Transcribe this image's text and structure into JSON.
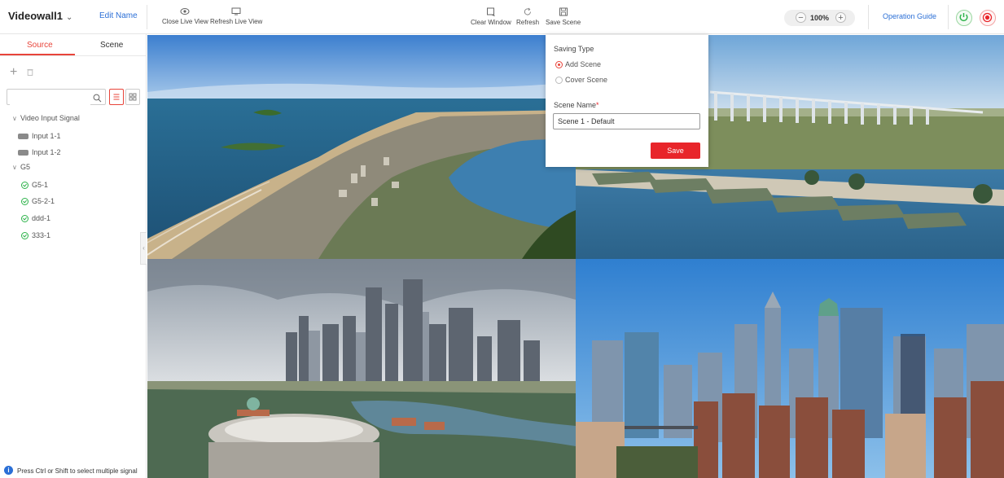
{
  "header": {
    "wall_name": "Videowall1",
    "edit_name": "Edit Name",
    "toolbar_left": [
      {
        "label": "Close Live View",
        "icon": "eye-icon"
      },
      {
        "label": "Refresh Live View",
        "icon": "monitor-icon"
      }
    ],
    "toolbar_center": [
      {
        "label": "Clear Window",
        "icon": "clear-window-icon"
      },
      {
        "label": "Refresh",
        "icon": "refresh-icon"
      },
      {
        "label": "Save Scene",
        "icon": "save-icon"
      }
    ],
    "zoom": "100%",
    "operation_guide": "Operation Guide"
  },
  "sidebar": {
    "tabs": [
      {
        "label": "Source",
        "active": true
      },
      {
        "label": "Scene",
        "active": false
      }
    ],
    "search_placeholder": "",
    "tree": [
      {
        "label": "Video Input Signal",
        "type": "group",
        "expanded": true
      },
      {
        "label": "Input 1-1",
        "type": "signal"
      },
      {
        "label": "Input 1-2",
        "type": "signal"
      },
      {
        "label": "G5",
        "type": "group",
        "expanded": true
      },
      {
        "label": "G5-1",
        "type": "device"
      },
      {
        "label": "G5-2-1",
        "type": "device"
      },
      {
        "label": "ddd-1",
        "type": "device"
      },
      {
        "label": "333-1",
        "type": "device"
      }
    ],
    "hint": "Press Ctrl or Shift to select multiple signal",
    "accent_color": "#e8443a"
  },
  "windows": [
    {
      "name": "window-1",
      "scene": "coastal-city-aerial"
    },
    {
      "name": "window-2",
      "scene": "bridge-and-piers"
    },
    {
      "name": "window-3",
      "scene": "singapore-skyline"
    },
    {
      "name": "window-4",
      "scene": "manhattan-skyline"
    }
  ],
  "save_popup": {
    "saving_type_label": "Saving Type",
    "options": [
      {
        "label": "Add Scene",
        "selected": true
      },
      {
        "label": "Cover Scene",
        "selected": false
      }
    ],
    "scene_name_label": "Scene Name",
    "required_mark": "*",
    "scene_name_value": "Scene 1 - Default",
    "save_label": "Save",
    "save_color": "#e8252a"
  }
}
